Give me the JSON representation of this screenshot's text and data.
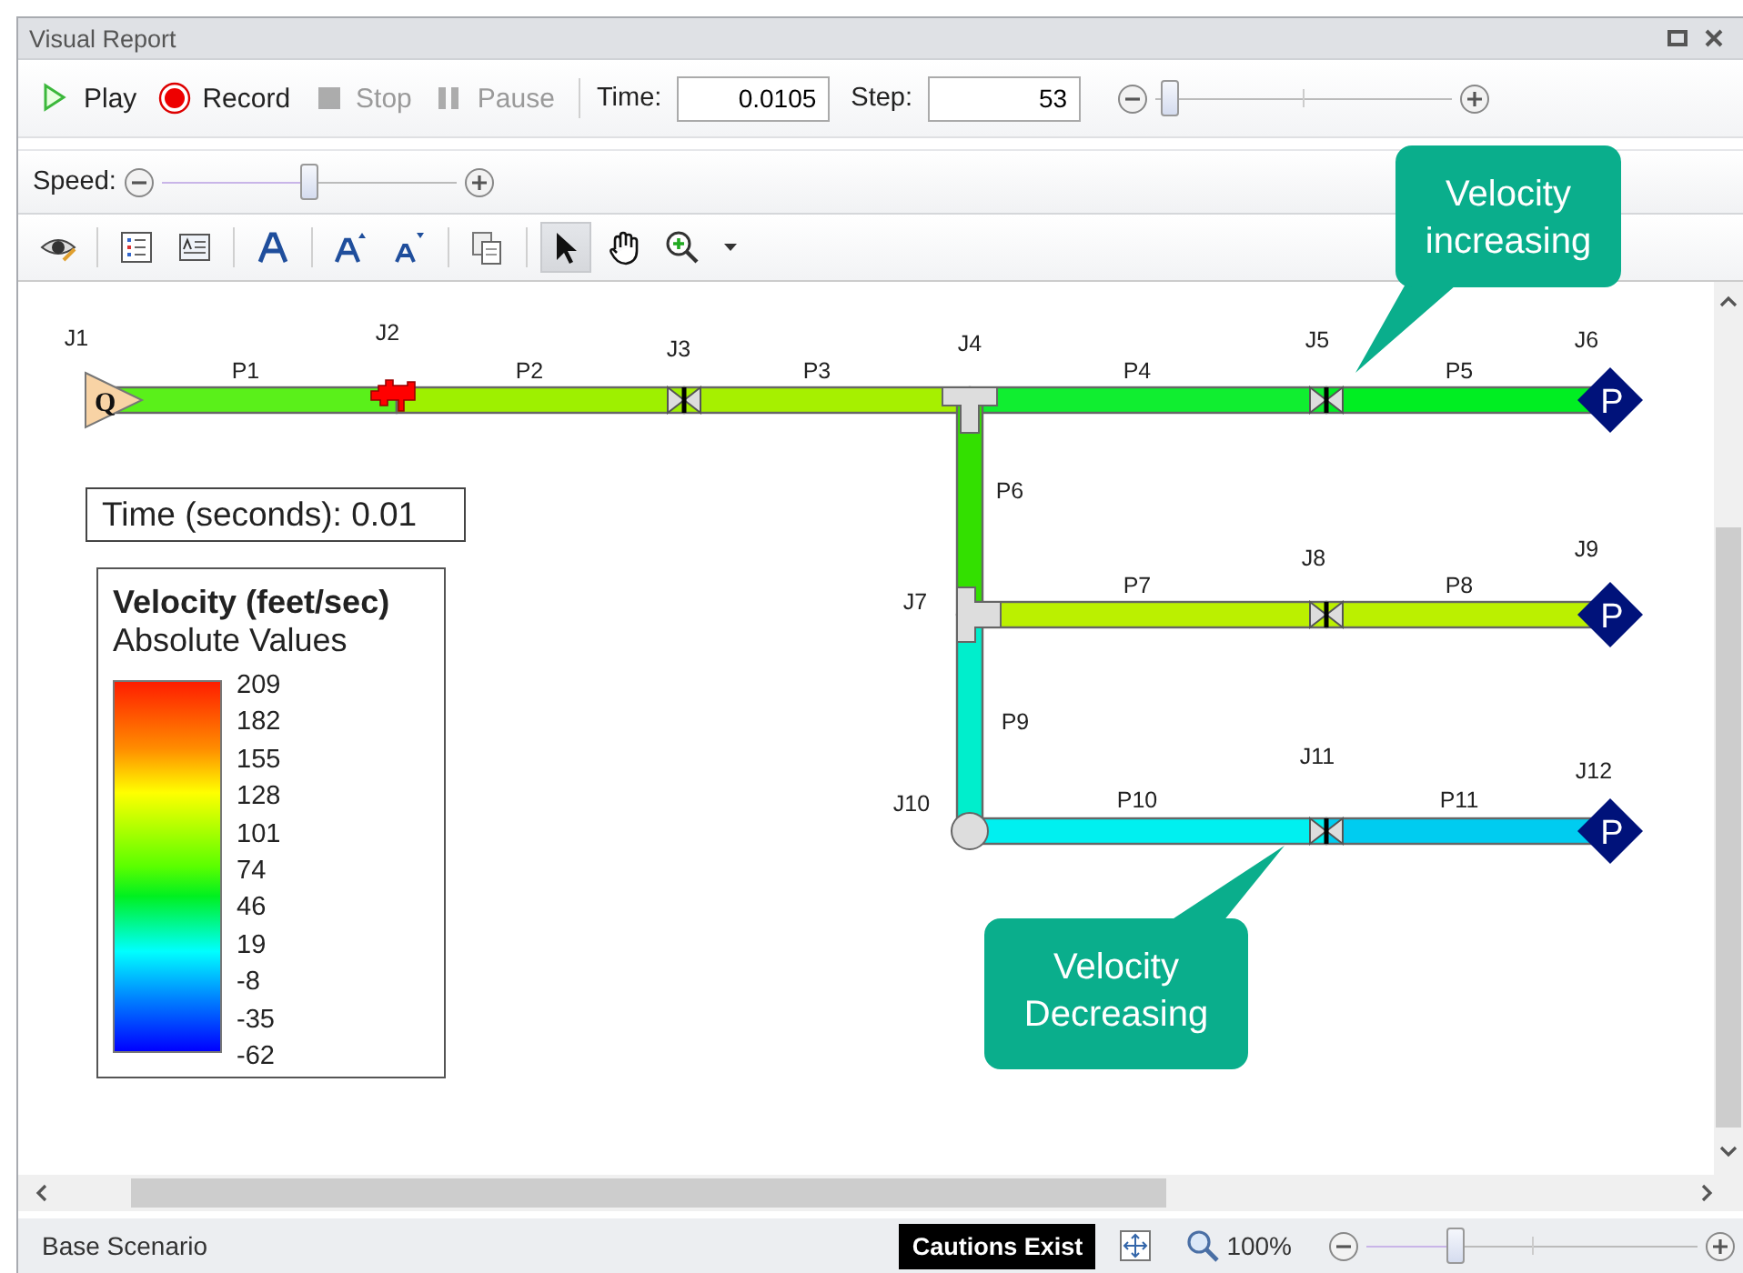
{
  "window": {
    "title": "Visual Report"
  },
  "playback": {
    "buttons": [
      {
        "label": "Play",
        "kind": "play",
        "disabled": false
      },
      {
        "label": "Record",
        "kind": "record",
        "disabled": false
      },
      {
        "label": "Stop",
        "kind": "stop",
        "disabled": true
      },
      {
        "label": "Pause",
        "kind": "pause",
        "disabled": true
      }
    ],
    "time": {
      "label": "Time:",
      "value": "0.0105"
    },
    "step": {
      "label": "Step:",
      "value": "53"
    },
    "step_slider": {
      "level": 0.05
    }
  },
  "speed": {
    "label": "Speed:",
    "level": 0.5
  },
  "tools": [
    {
      "kind": "eye",
      "selected": false
    },
    {
      "kind": "list",
      "selected": false
    },
    {
      "kind": "textbox",
      "selected": false
    },
    {
      "kind": "font",
      "selected": false
    },
    {
      "kind": "font_grow",
      "selected": false
    },
    {
      "kind": "font_shrink",
      "selected": false
    },
    {
      "kind": "copy",
      "selected": false
    },
    {
      "kind": "pointer",
      "selected": true
    },
    {
      "kind": "hand",
      "selected": false
    },
    {
      "kind": "zoom_in",
      "selected": false
    },
    {
      "kind": "dropdown",
      "selected": false
    }
  ],
  "diagram": {
    "junctions": [
      {
        "label": "J1",
        "kind": "flow_source",
        "symbol": "Q"
      },
      {
        "label": "J2",
        "kind": "pump"
      },
      {
        "label": "J3",
        "kind": "valve"
      },
      {
        "label": "J4",
        "kind": "tee"
      },
      {
        "label": "J5",
        "kind": "valve"
      },
      {
        "label": "J6",
        "kind": "pressure",
        "symbol": "P"
      },
      {
        "label": "J7",
        "kind": "tee"
      },
      {
        "label": "J8",
        "kind": "valve"
      },
      {
        "label": "J9",
        "kind": "pressure",
        "symbol": "P"
      },
      {
        "label": "J10",
        "kind": "branch"
      },
      {
        "label": "J11",
        "kind": "valve"
      },
      {
        "label": "J12",
        "kind": "pressure",
        "symbol": "P"
      }
    ],
    "pipes": [
      {
        "label": "P1",
        "color": "#5af01a"
      },
      {
        "label": "P2",
        "color": "#9ef000"
      },
      {
        "label": "P3",
        "color": "#a6f000"
      },
      {
        "label": "P4",
        "color": "#10ee30"
      },
      {
        "label": "P5",
        "color": "#00ee22"
      },
      {
        "label": "P6",
        "color": "#33e000"
      },
      {
        "label": "P7",
        "color": "#bbf000"
      },
      {
        "label": "P8",
        "color": "#bbf000"
      },
      {
        "label": "P9",
        "color": "#00eecc"
      },
      {
        "label": "P10",
        "color": "#00f0f0"
      },
      {
        "label": "P11",
        "color": "#00ccf0"
      }
    ],
    "time_box": "Time (seconds): 0.01",
    "legend": {
      "title": "Velocity (feet/sec)",
      "subtitle": "Absolute Values",
      "ticks": [
        "209",
        "182",
        "155",
        "128",
        "101",
        "74",
        "46",
        "19",
        "-8",
        "-35",
        "-62"
      ]
    }
  },
  "callouts": [
    {
      "lines": [
        "Velocity",
        "increasing"
      ]
    },
    {
      "lines": [
        "Velocity",
        "Decreasing"
      ]
    }
  ],
  "status_bar": {
    "scenario": "Base Scenario",
    "cautions": "Cautions Exist",
    "zoom": "100%",
    "zoom_slider": {
      "level": 0.27
    }
  }
}
